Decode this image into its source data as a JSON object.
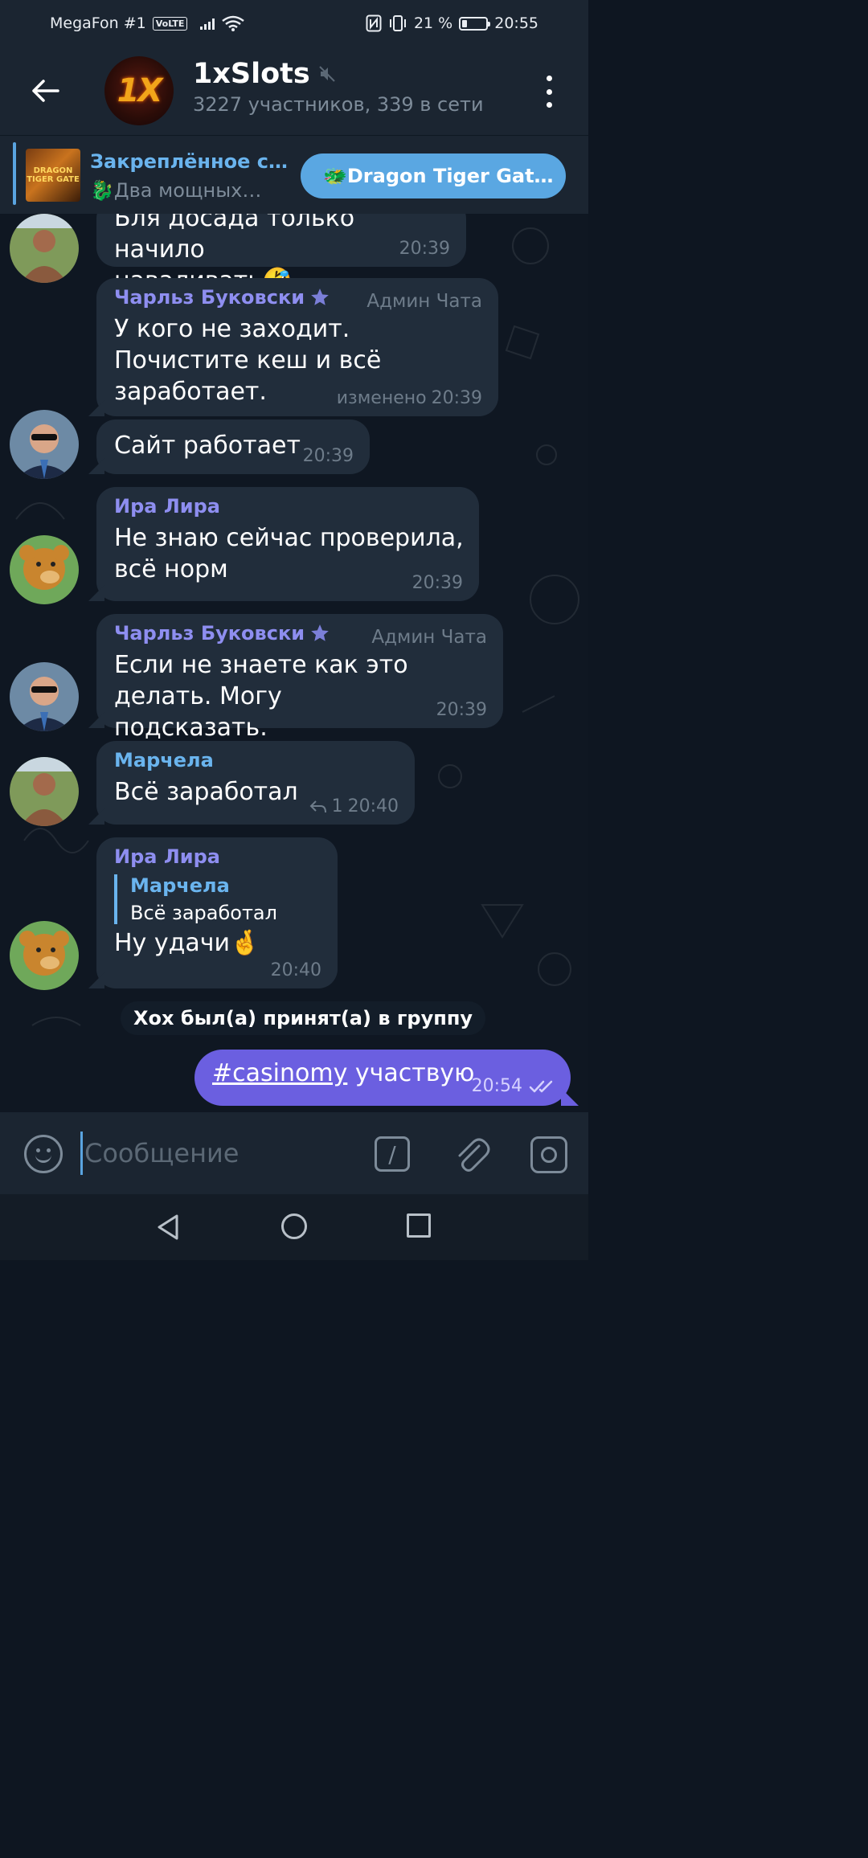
{
  "status_bar": {
    "carrier": "MegaFon #1",
    "volte": "VoLTE",
    "battery_percent": "21 %",
    "battery_level": 0.21,
    "time": "20:55"
  },
  "header": {
    "title": "1xSlots",
    "subtitle": "3227 участников, 339 в сети",
    "avatar_text": "1X",
    "muted": true
  },
  "pinned": {
    "title": "Закреплённое с…",
    "text": "🐉Два мощных…",
    "thumb_text": "DRAGON TIGER GATE",
    "button_label": "🐲Dragon Tiger Gat…"
  },
  "messages": [
    {
      "text_partial": "Бля досада только начило",
      "text": "наваливать🤣",
      "time": "20:39"
    },
    {
      "sender": "Чарльз Буковски",
      "role": "Админ Чата",
      "text": "У кого не заходит. Почистите кеш и всё заработает.",
      "edited": "изменено",
      "time": "20:39"
    },
    {
      "text": "Сайт работает",
      "time": "20:39"
    },
    {
      "sender": "Ира Лира",
      "text": "Не знаю сейчас проверила, всё норм",
      "time": "20:39"
    },
    {
      "sender": "Чарльз Буковски",
      "role": "Админ Чата",
      "text": "Если не знаете как это делать. Могу подсказать.",
      "time": "20:39"
    },
    {
      "sender": "Марчела",
      "text": "Всё заработал",
      "replies": "1",
      "time": "20:40"
    },
    {
      "sender": "Ира Лира",
      "reply_to_name": "Марчела",
      "reply_to_text": "Всё заработал",
      "text": "Ну удачи🤞",
      "time": "20:40"
    }
  ],
  "service_message": "Хох был(а) принят(а) в группу",
  "outgoing": {
    "hashtag": "#casinomy",
    "text": " участвую",
    "time": "20:54"
  },
  "input": {
    "placeholder": "Сообщение",
    "value": ""
  },
  "colors": {
    "accent": "#5aa7e2",
    "outgoing_bubble": "#6b5fe0",
    "incoming_bubble": "#212d3b",
    "sender_purple": "#8e8ef0",
    "sender_blue": "#6ab4ee"
  }
}
